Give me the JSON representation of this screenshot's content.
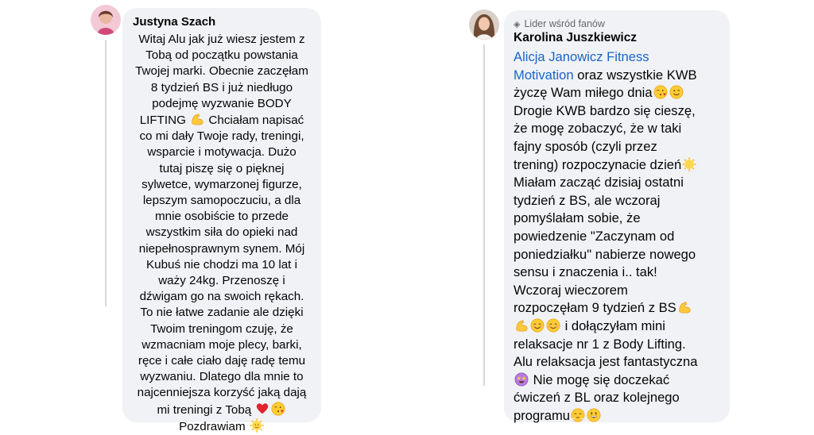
{
  "comments": [
    {
      "author": "Justyna Szach",
      "lines": [
        "Witaj Alu jak już wiesz jestem z",
        "Tobą od początku powstania",
        "Twojej marki. Obecnie zaczęłam",
        "8 tydzień BS i już niedługo",
        "podejmę wyzwanie BODY",
        "LIFTING",
        "Chciałam napisać",
        "co mi dały Twoje rady, treningi,",
        "wsparcie i motywacja. Dużo",
        "tutaj piszę się o pięknej",
        "sylwetce, wymarzonej figurze,",
        "lepszym samopoczuciu, a dla",
        "mnie osobiście to przede",
        "wszystkim siła do opieki nad",
        "niepełnosprawnym synem. Mój",
        "Kubuś nie chodzi ma 10 lat i",
        "waży 24kg. Przenoszę i",
        "dźwigam go na swoich rękach.",
        "To nie łatwe zadanie ale dzięki",
        "Twoim treningom czuję, że",
        "wzmacniam moje plecy, barki,",
        "ręce i całe ciało daję radę temu",
        "wyzwaniu. Dlatego dla mnie to",
        "najcenniejsza korzyść jaką dają",
        "mi treningi z Tobą",
        "Pozdrawiam"
      ],
      "emojis": [
        "flexed-biceps",
        "red-heart",
        "face-blowing-kiss",
        "sun-with-face"
      ]
    },
    {
      "badge": "Lider wśród fanów",
      "author": "Karolina Juszkiewicz",
      "mention": "Alicja Janowicz Fitness",
      "mention_line2": "Motivation",
      "lines": [
        "oraz wszystkie KWB",
        "życzę Wam miłego dnia",
        "Drogie KWB bardzo się cieszę,",
        "że mogę zobaczyć, że w taki",
        "fajny sposób (czyli przez",
        "trening) rozpoczynacie dzień",
        "Miałam zacząć dzisiaj ostatni",
        "tydzień z BS, ale wczoraj",
        "pomyślałam sobie, że",
        "powiedzenie \"Zaczynam od",
        "poniedziałku\" nabierze nowego",
        "sensu i znaczenia i.. tak!",
        "Wczoraj wieczorem",
        "rozpoczęłam 9 tydzień z BS",
        "i dołączyłam mini",
        "relaksacje nr 1 z Body Lifting.",
        "Alu relaksacja jest fantastyczna",
        "Nie mogę się doczekać",
        "ćwiczeń z BL oraz kolejnego",
        "programu"
      ],
      "emojis": [
        "face-blowing-kiss",
        "winking-face",
        "sun",
        "flexed-biceps",
        "smiling-face",
        "star-struck",
        "face-with-steam",
        "grinning-face"
      ]
    }
  ]
}
